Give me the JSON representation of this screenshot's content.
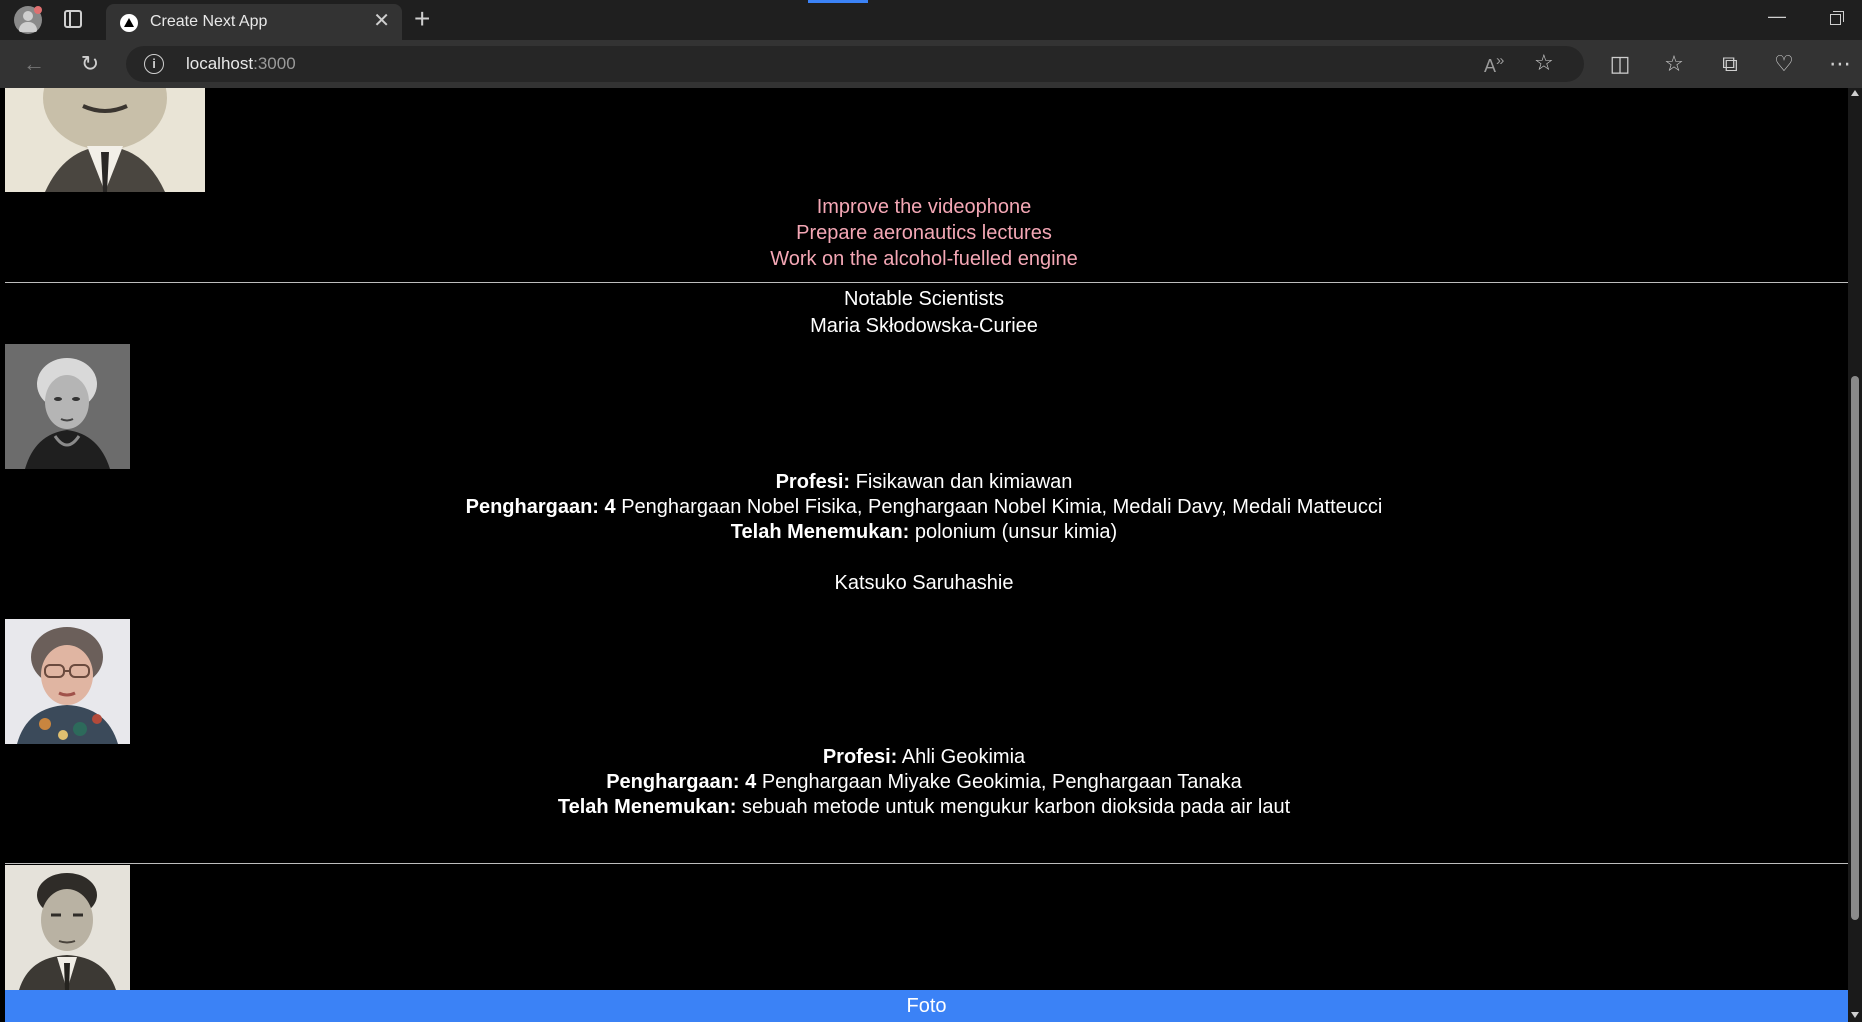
{
  "browser": {
    "tab_title": "Create Next App",
    "url_host": "localhost",
    "url_port": ":3000",
    "accent_color": "#3b82f6"
  },
  "page": {
    "todos": [
      "Improve the videophone",
      "Prepare aeronautics lectures",
      "Work on the alcohol-fuelled engine"
    ],
    "section_title": "Notable Scientists",
    "scientists": [
      {
        "name": "Maria Skłodowska-Curiee",
        "profession_label": "Profesi:",
        "profession": "Fisikawan dan kimiawan",
        "awards_label": "Penghargaan: 4",
        "awards": "Penghargaan Nobel Fisika, Penghargaan Nobel Kimia, Medali Davy, Medali Matteucci",
        "discovered_label": "Telah Menemukan:",
        "discovered": "polonium (unsur kimia)"
      },
      {
        "name": "Katsuko Saruhashie",
        "profession_label": "Profesi:",
        "profession": "Ahli Geokimia",
        "awards_label": "Penghargaan: 4",
        "awards": "Penghargaan Miyake Geokimia, Penghargaan Tanaka",
        "discovered_label": "Telah Menemukan:",
        "discovered": "sebuah metode untuk mengukur karbon dioksida pada air laut"
      }
    ],
    "footer_label": "Foto",
    "footer_color": "#3b82f6",
    "todo_color": "#f4a7b5"
  }
}
